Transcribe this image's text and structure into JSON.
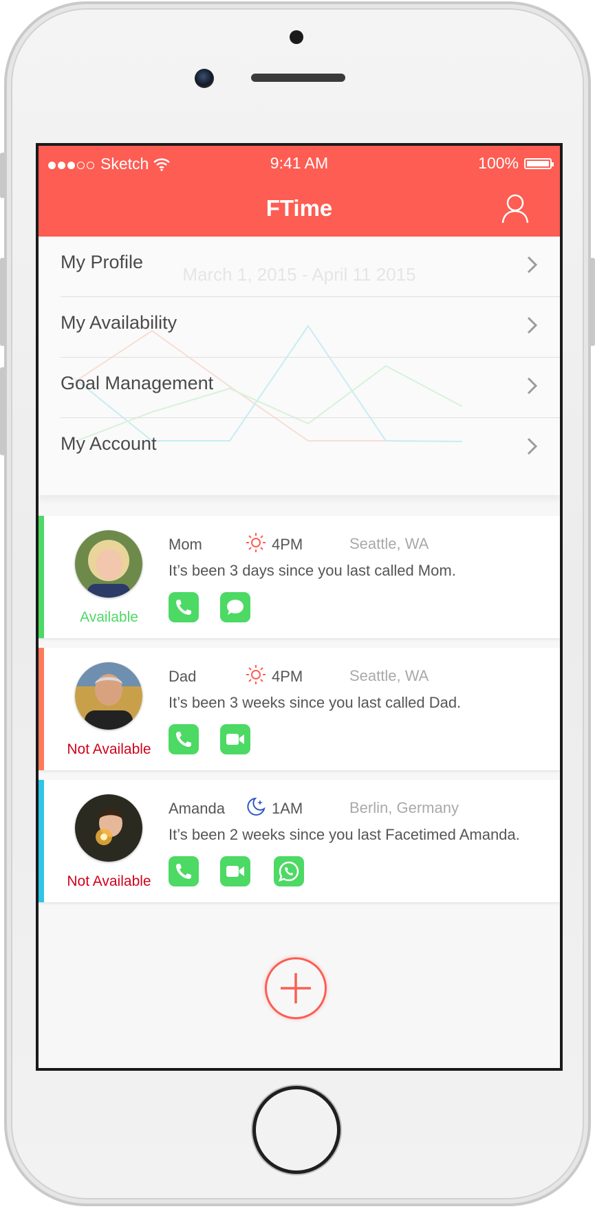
{
  "status_bar": {
    "carrier": "Sketch",
    "time": "9:41 AM",
    "battery": "100%"
  },
  "nav": {
    "title": "FTime",
    "profile_icon": "user-icon"
  },
  "menu": {
    "background_date": "March 1, 2015 - April 11 2015",
    "items": [
      {
        "label": "My Profile"
      },
      {
        "label": "My Availability"
      },
      {
        "label": "Goal Management"
      },
      {
        "label": "My Account"
      }
    ]
  },
  "contacts": [
    {
      "name": "Mom",
      "time_icon": "sun-icon",
      "time": "4PM",
      "location": "Seattle, WA",
      "message": "It’s been 3 days since you last called Mom.",
      "status": "Available",
      "status_color": "#4cd964",
      "accent": "#4cd964",
      "actions": [
        "phone-icon",
        "message-icon"
      ]
    },
    {
      "name": "Dad",
      "time_icon": "sun-icon",
      "time": "4PM",
      "location": "Seattle, WA",
      "message": "It’s been 3 weeks since you last called Dad.",
      "status": "Not Available",
      "status_color": "#d0021b",
      "accent": "#fd7b5b",
      "actions": [
        "phone-icon",
        "video-icon"
      ]
    },
    {
      "name": "Amanda",
      "time_icon": "moon-icon",
      "time": "1AM",
      "location": "Berlin, Germany",
      "message": "It’s been 2 weeks since you last Facetimed Amanda.",
      "status": "Not Available",
      "status_color": "#d0021b",
      "accent": "#2ec5e6",
      "actions": [
        "phone-icon",
        "video-icon",
        "whatsapp-icon"
      ]
    }
  ],
  "colors": {
    "brand": "#fd5d53",
    "action_green": "#4cd964"
  }
}
